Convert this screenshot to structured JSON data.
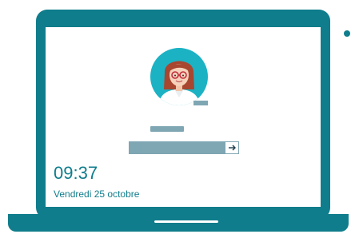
{
  "lock_screen": {
    "time": "09:37",
    "date": "Vendredi 25 octobre"
  },
  "icons": {
    "avatar": "user-avatar-icon",
    "submit": "arrow-right-icon"
  },
  "colors": {
    "frame": "#0f7d8c",
    "avatar_background": "#1bb2c4",
    "field": "#7fa6b3",
    "text": "#0f7d8c"
  }
}
